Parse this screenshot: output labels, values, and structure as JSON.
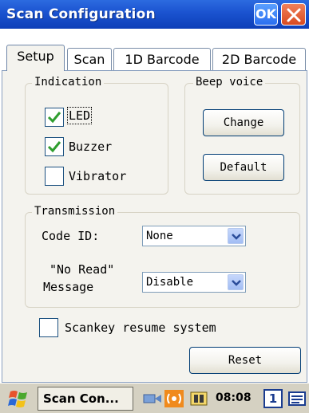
{
  "window": {
    "title": "Scan Configuration",
    "ok_label": "OK"
  },
  "tabs": [
    "Setup",
    "Scan",
    "1D Barcode",
    "2D Barcode"
  ],
  "active_tab": "Setup",
  "indication": {
    "label": "Indication",
    "items": [
      {
        "label": "LED",
        "checked": true
      },
      {
        "label": "Buzzer",
        "checked": true
      },
      {
        "label": "Vibrator",
        "checked": false
      }
    ]
  },
  "beep_voice": {
    "label": "Beep voice",
    "change_label": "Change",
    "default_label": "Default"
  },
  "transmission": {
    "label": "Transmission",
    "code_id_label": "Code ID:",
    "code_id_value": "None",
    "no_read_label_1": "\"No Read\"",
    "no_read_label_2": "Message",
    "no_read_value": "Disable"
  },
  "scankey": {
    "label": "Scankey resume system",
    "checked": false
  },
  "reset_label": "Reset",
  "taskbar": {
    "task_label": "Scan Con...",
    "time": "08:08",
    "input_indicator": "1"
  },
  "colors": {
    "titlebar": "#1a52cf",
    "check": "#2f9e2f",
    "taskbar": "#d5d1c2"
  }
}
